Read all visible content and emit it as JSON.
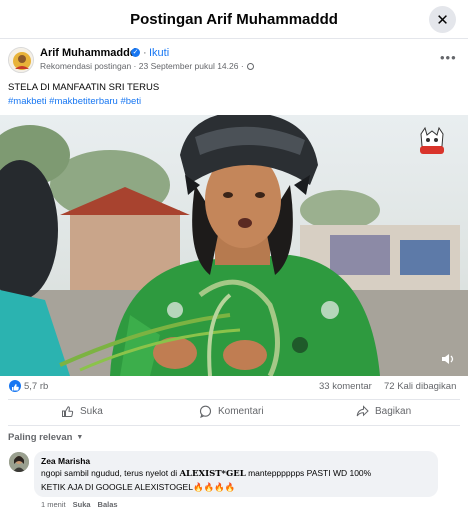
{
  "header": {
    "title": "Postingan Arif Muhammaddd",
    "close_icon": "close-icon"
  },
  "post": {
    "author_name": "Arif Muhammaddd",
    "separator": "·",
    "follow_label": "Ikuti",
    "meta_text": "Rekomendasi postingan · 23 September pukul 14.26 ·",
    "caption": "STELA DI MANFAATIN SRI TERUS",
    "hashtags": "#makbeti #makbetiterbaru #beti",
    "more_icon": "more-options-icon"
  },
  "stats": {
    "likes": "5,7 rb",
    "comments": "33 komentar",
    "shares": "72 Kali dibagikan"
  },
  "actions": {
    "like_label": "Suka",
    "comment_label": "Komentari",
    "share_label": "Bagikan"
  },
  "comments_section": {
    "sort_label": "Paling relevan",
    "comment": {
      "name": "Zea Marisha",
      "text_1a": "ngopi sambil ngudud, terus nyelot di ",
      "brand": "ALEXIST*GEL",
      "text_1b": " mantepppppps PASTI WD 100%",
      "text_2": "KETIK AJA DI GOOGLE ALEXISTOGEL🔥🔥🔥🔥",
      "time": "1 menit",
      "like_label": "Suka",
      "reply_label": "Balas"
    }
  },
  "colors": {
    "accent": "#1877f2",
    "secondary_text": "#65676b",
    "bubble": "#f0f2f5"
  }
}
